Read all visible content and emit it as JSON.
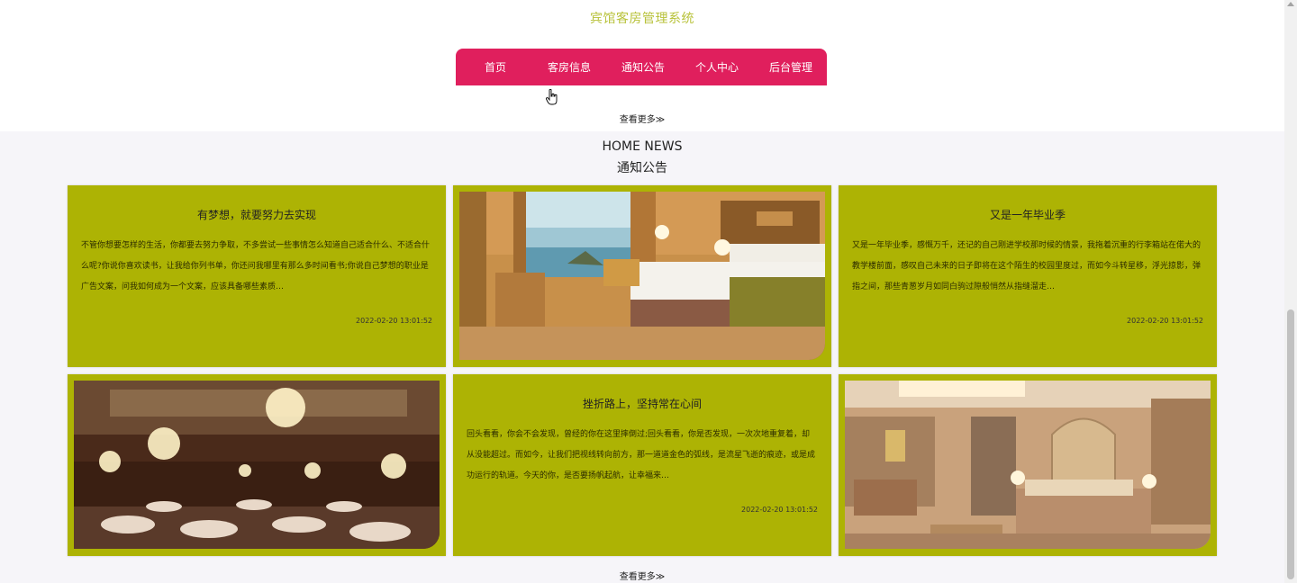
{
  "site": {
    "title": "宾馆客房管理系统"
  },
  "nav": {
    "items": [
      "首页",
      "客房信息",
      "通知公告",
      "个人中心",
      "后台管理"
    ]
  },
  "more_label": "查看更多≫",
  "news": {
    "heading_en": "HOME NEWS",
    "heading_cn": "通知公告"
  },
  "cards": [
    {
      "title": "有梦想，就要努力去实现",
      "body": "不管你想要怎样的生活，你都要去努力争取，不多尝试一些事情怎么知道自己适合什么、不适合什么呢?你说你喜欢读书，让我给你列书单，你还问我哪里有那么多时间看书;你说自己梦想的职业是广告文案，问我如何成为一个文案，应该具备哪些素质…",
      "date": "2022-02-20 13:01:52"
    },
    {
      "image": "hotel-room-image"
    },
    {
      "title": "又是一年毕业季",
      "body": "又是一年毕业季，感慨万千，还记的自己刚进学校那时候的情景，我拖着沉重的行李箱站在偌大的教学楼前面，感叹自己未来的日子即将在这个陌生的校园里度过，而如今斗转星移，浮光掠影，弹指之间，那些青葱岁月如同白驹过隙般悄然从指缝溜走…",
      "date": "2022-02-20 13:01:52"
    },
    {
      "image": "banquet-hall-image"
    },
    {
      "title": "挫折路上，坚持常在心间",
      "body": "回头看看，你会不会发现，曾经的你在这里摔倒过;回头看看，你是否发现，一次次地重复着，却从没能超过。而如今，让我们把视线转向前方，那一道道金色的弧线，是流星飞逝的痕迹，或是成功运行的轨道。今天的你，是否要扬帆起航，让幸福来…",
      "date": "2022-02-20 13:01:52"
    },
    {
      "image": "luxury-suite-image"
    }
  ],
  "colors": {
    "nav": "#e01f5d",
    "card": "#adb304",
    "title": "#b8c23a"
  }
}
